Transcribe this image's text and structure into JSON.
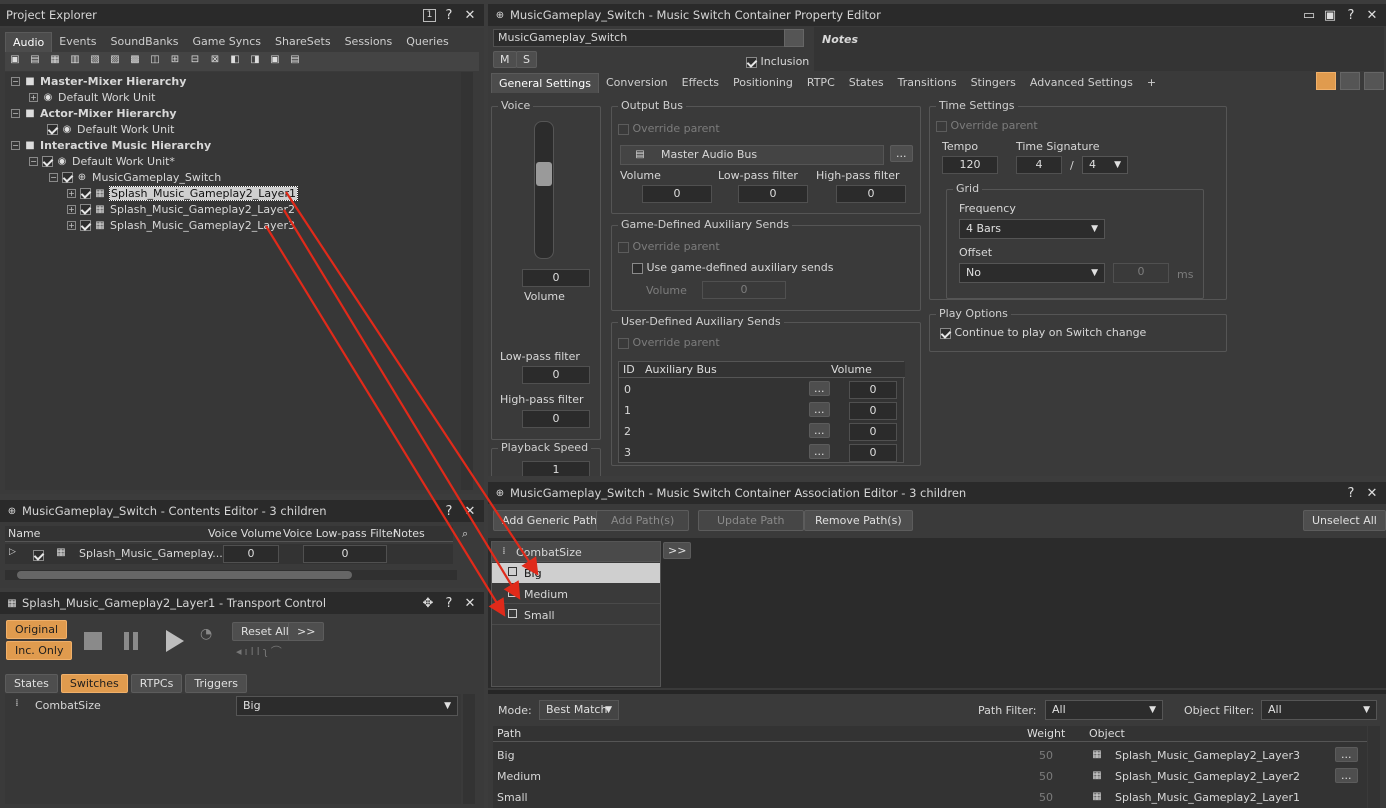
{
  "explorer": {
    "title": "Project Explorer",
    "tabs": [
      "Audio",
      "Events",
      "SoundBanks",
      "Game Syncs",
      "ShareSets",
      "Sessions",
      "Queries"
    ],
    "active_tab": "Audio",
    "tree": {
      "master": "Master-Mixer Hierarchy",
      "master_wu": "Default Work Unit",
      "actor": "Actor-Mixer Hierarchy",
      "actor_wu": "Default Work Unit",
      "interactive": "Interactive Music Hierarchy",
      "interactive_wu": "Default Work Unit*",
      "switch": "MusicGameplay_Switch",
      "layer1": "Splash_Music_Gameplay2_Layer1",
      "layer2": "Splash_Music_Gameplay2_Layer2",
      "layer3": "Splash_Music_Gameplay2_Layer3"
    }
  },
  "contents": {
    "title": "MusicGameplay_Switch - Contents Editor - 3 children",
    "cols": [
      "Name",
      "Voice Volume",
      "Voice Low-pass Filter",
      "Notes"
    ],
    "row_name": "Splash_Music_Gameplay...",
    "row_volume": "0",
    "row_lpf": "0"
  },
  "transport": {
    "title": "Splash_Music_Gameplay2_Layer1 - Transport Control",
    "original": "Original",
    "inc_only": "Inc. Only",
    "reset_all": "Reset All",
    "more": ">>",
    "tabs": [
      "States",
      "Switches",
      "RTPCs",
      "Triggers"
    ],
    "active_tab": "Switches",
    "switch_group": "CombatSize",
    "switch_value": "Big"
  },
  "property": {
    "title": "MusicGameplay_Switch - Music Switch Container Property Editor",
    "name": "MusicGameplay_Switch",
    "inclusion": "Inclusion",
    "m": "M",
    "s": "S",
    "notes": "Notes",
    "tabs": [
      "General Settings",
      "Conversion",
      "Effects",
      "Positioning",
      "RTPC",
      "States",
      "Transitions",
      "Stingers",
      "Advanced Settings",
      "+"
    ],
    "active_tab": "General Settings",
    "voice": {
      "label": "Voice",
      "volume_value": "0",
      "volume_label": "Volume",
      "lpf_label": "Low-pass filter",
      "lpf_value": "0",
      "hpf_label": "High-pass filter",
      "hpf_value": "0",
      "speed_label": "Playback Speed",
      "speed_value": "1"
    },
    "output_bus": {
      "label": "Output Bus",
      "override": "Override parent",
      "bus": "Master Audio Bus",
      "browse": "...",
      "volume_label": "Volume",
      "volume_value": "0",
      "lpf_label": "Low-pass filter",
      "lpf_value": "0",
      "hpf_label": "High-pass filter",
      "hpf_value": "0"
    },
    "game_aux": {
      "label": "Game-Defined Auxiliary Sends",
      "override": "Override parent",
      "use": "Use game-defined auxiliary sends",
      "volume_label": "Volume",
      "volume_value": "0"
    },
    "user_aux": {
      "label": "User-Defined Auxiliary Sends",
      "override": "Override parent",
      "cols": [
        "ID",
        "Auxiliary Bus",
        "Volume"
      ],
      "rows": [
        {
          "id": "0",
          "vol": "0"
        },
        {
          "id": "1",
          "vol": "0"
        },
        {
          "id": "2",
          "vol": "0"
        },
        {
          "id": "3",
          "vol": "0"
        }
      ]
    },
    "time": {
      "label": "Time Settings",
      "override": "Override parent",
      "tempo_label": "Tempo",
      "tempo": "120",
      "sig_label": "Time Signature",
      "sig_num": "4",
      "sig_den": "4",
      "slash": "/",
      "grid_label": "Grid",
      "freq_label": "Frequency",
      "freq": "4 Bars",
      "offset_label": "Offset",
      "offset": "No",
      "offset_value": "0",
      "ms": "ms"
    },
    "play": {
      "label": "Play Options",
      "continue": "Continue to play on Switch change"
    }
  },
  "association": {
    "title": "MusicGameplay_Switch - Music Switch Container Association Editor - 3 children",
    "add_generic": "Add Generic Path",
    "add_paths": "Add Path(s)",
    "update_path": "Update Path",
    "remove_paths": "Remove Path(s)",
    "unselect_all": "Unselect All",
    "group": "CombatSize",
    "expand": ">>",
    "states": [
      "Big",
      "Medium",
      "Small"
    ],
    "mode_label": "Mode:",
    "mode": "Best Match",
    "path_filter_label": "Path Filter:",
    "path_filter": "All",
    "object_filter_label": "Object Filter:",
    "object_filter": "All",
    "cols": [
      "Path",
      "Weight",
      "Object"
    ],
    "rows": [
      {
        "path": "Big",
        "weight": "50",
        "object": "Splash_Music_Gameplay2_Layer3"
      },
      {
        "path": "Medium",
        "weight": "50",
        "object": "Splash_Music_Gameplay2_Layer2"
      },
      {
        "path": "Small",
        "weight": "50",
        "object": "Splash_Music_Gameplay2_Layer1"
      }
    ]
  },
  "colors": {
    "accent": "#e09b4e",
    "arrow": "#e02a1a",
    "panel": "#3a3a3a",
    "titlebar": "#2a2a2a"
  }
}
